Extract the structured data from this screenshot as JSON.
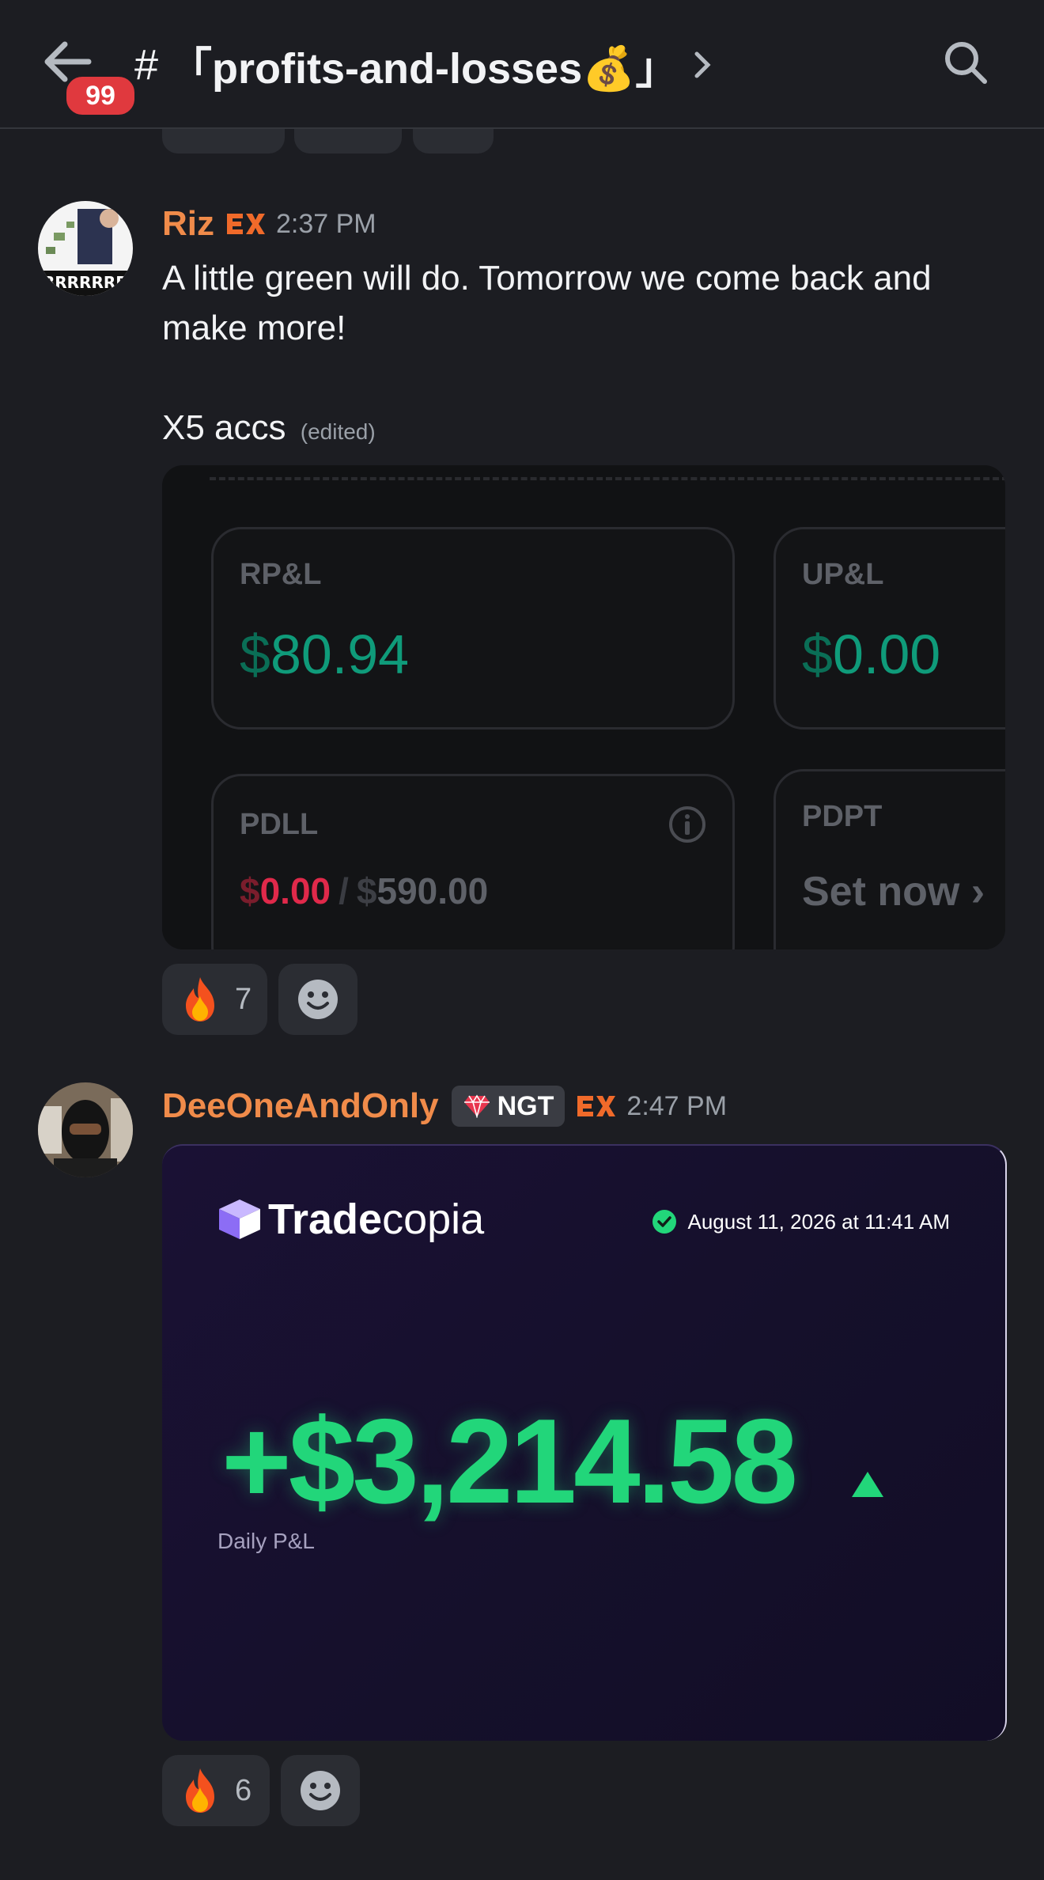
{
  "header": {
    "unread_count": "99",
    "hash": "#",
    "channel_name": "「profits-and-losses💰」"
  },
  "messages": [
    {
      "author": "Riz",
      "time": "2:37 PM",
      "text_line1": "A little green will do. Tomorrow we come back and",
      "text_line2": "make more!",
      "text_line3": "X5 accs",
      "edited": "(edited)",
      "embed": {
        "rpl_label": "RP&L",
        "rpl_currency": "$",
        "rpl_value": "80.94",
        "upl_label": "UP&L",
        "upl_currency": "$",
        "upl_value": "0.00",
        "pdll_label": "PDLL",
        "pdll_currency": "$",
        "pdll_used": "0.00",
        "pdll_separator": "/",
        "pdll_limit_currency": "$",
        "pdll_limit": "590.00",
        "pdpt_label": "PDPT",
        "pdpt_action": "Set now",
        "pdpt_chevron": "›"
      },
      "reactions": [
        {
          "emoji": "fire-icon",
          "count": "7"
        }
      ]
    },
    {
      "author": "DeeOneAndOnly",
      "role_tag": "NGT",
      "time": "2:47 PM",
      "embed": {
        "brand_bold": "Trade",
        "brand_light": "copia",
        "date": "August 11, 2026 at 11:41 AM",
        "pnl_value": "+$3,214.58",
        "pnl_label": "Daily P&L",
        "trend": "up"
      },
      "reactions": [
        {
          "emoji": "fire-icon",
          "count": "6"
        }
      ]
    }
  ],
  "colors": {
    "background": "#1c1d22",
    "username": "#f08b4a",
    "profit_green": "#22d67a",
    "loss_red": "#e0294a",
    "badge_red": "#e0393e"
  }
}
